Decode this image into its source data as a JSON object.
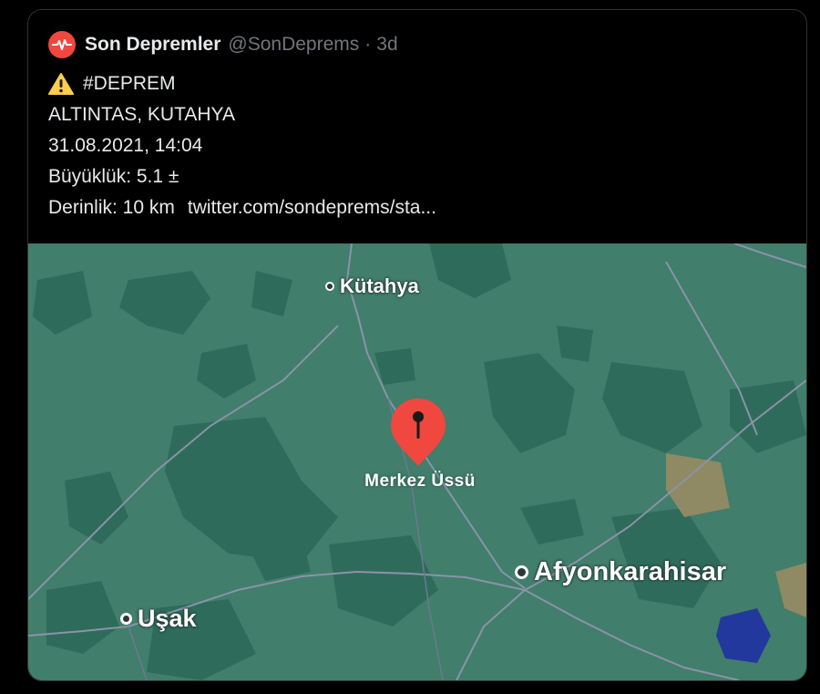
{
  "tweet": {
    "author_name": "Son Depremler",
    "handle": "@SonDeprems",
    "separator": "·",
    "time": "3d",
    "avatar_icon": "heartbeat-icon",
    "lines": {
      "hashtag": "#DEPREM",
      "location": "ALTINTAS, KUTAHYA",
      "datetime": "31.08.2021, 14:04",
      "magnitude": "Büyüklük: 5.1 ±",
      "depth": "Derinlik: 10 km",
      "link": "twitter.com/sondeprems/sta..."
    },
    "warning_icon": "warning-icon"
  },
  "map": {
    "land_color": "#417e6c",
    "cities": {
      "kutahya": "Kütahya",
      "afyon": "Afyonkarahisar",
      "usak": "Uşak"
    },
    "epicenter": {
      "label": "Merkez Üssü",
      "pin_color": "#f0473f",
      "icon": "map-pin-icon"
    }
  }
}
